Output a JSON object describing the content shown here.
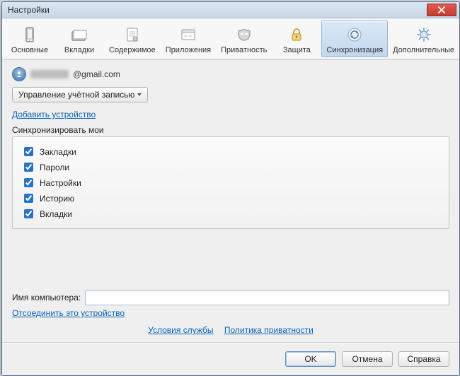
{
  "window": {
    "title": "Настройки"
  },
  "tabs": [
    {
      "id": "general",
      "label": "Основные"
    },
    {
      "id": "tabs",
      "label": "Вкладки"
    },
    {
      "id": "content",
      "label": "Содержимое"
    },
    {
      "id": "apps",
      "label": "Приложения"
    },
    {
      "id": "privacy",
      "label": "Приватность"
    },
    {
      "id": "security",
      "label": "Защита"
    },
    {
      "id": "sync",
      "label": "Синхронизация",
      "selected": true
    },
    {
      "id": "advanced",
      "label": "Дополнительные"
    }
  ],
  "account": {
    "email_suffix": "@gmail.com",
    "manage_button": "Управление учётной записью",
    "add_device_link": "Добавить устройство"
  },
  "sync": {
    "heading": "Синхронизировать мои",
    "items": [
      {
        "label": "Закладки",
        "checked": true
      },
      {
        "label": "Пароли",
        "checked": true
      },
      {
        "label": "Настройки",
        "checked": true
      },
      {
        "label": "Историю",
        "checked": true
      },
      {
        "label": "Вкладки",
        "checked": true
      }
    ]
  },
  "computer": {
    "label": "Имя компьютера:",
    "value": "",
    "unlink_link": "Отсоединить это устройство"
  },
  "policy": {
    "terms": "Условия службы",
    "privacy": "Политика приватности"
  },
  "footer": {
    "ok": "OK",
    "cancel": "Отмена",
    "help": "Справка"
  }
}
